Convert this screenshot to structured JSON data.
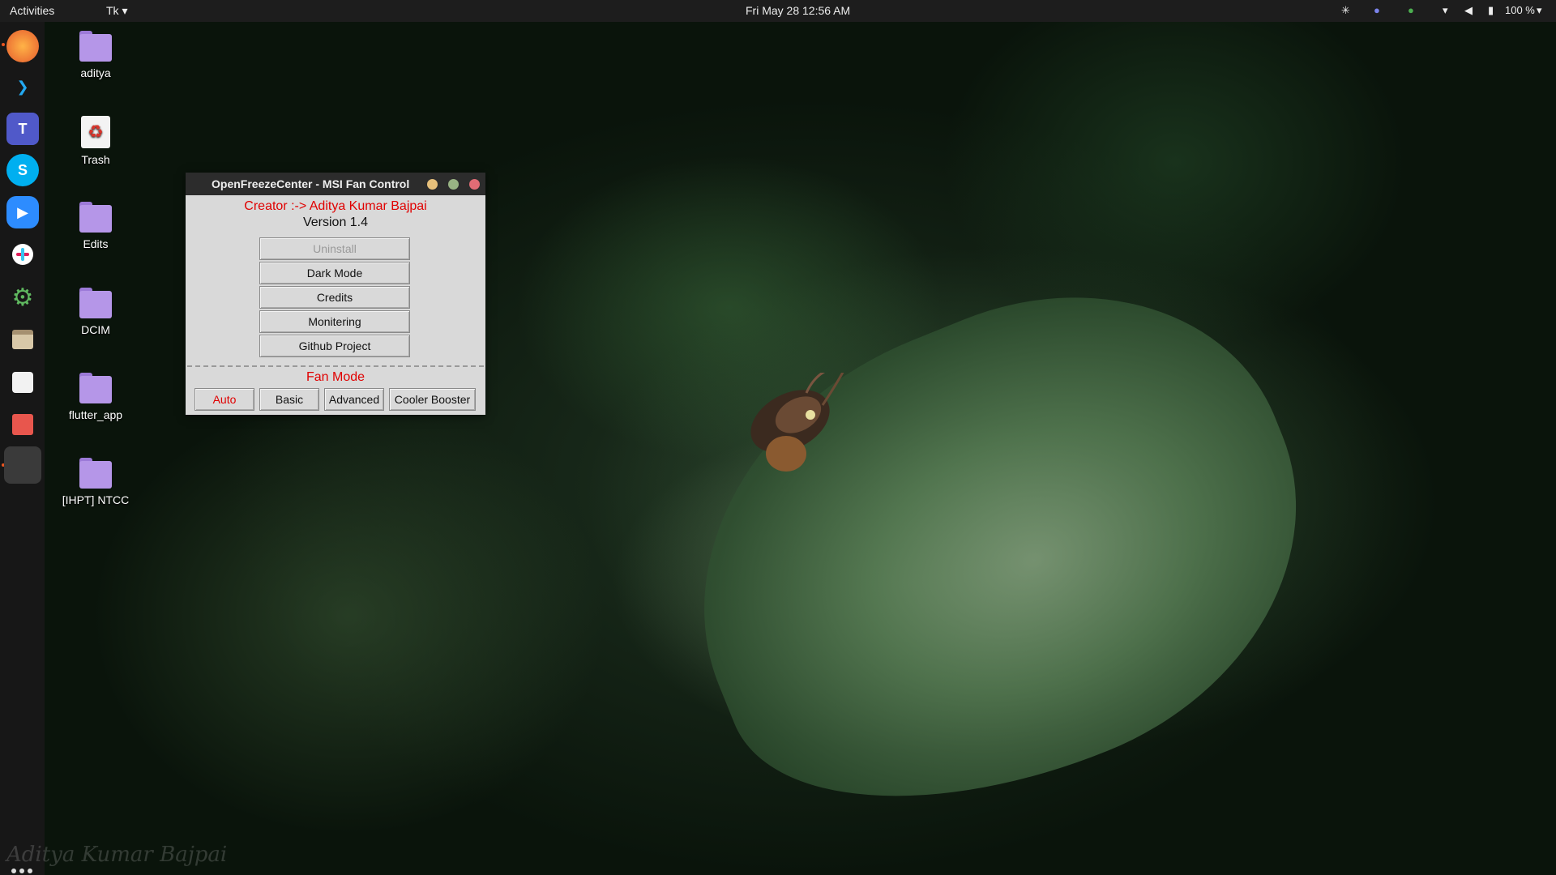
{
  "topbar": {
    "activities": "Activities",
    "app_menu": "Tk ▾",
    "clock": "Fri May 28  12:56 AM",
    "battery": "100 %",
    "tray_icons": [
      "slack-icon",
      "teams-icon",
      "check-shield-icon",
      "wifi-icon",
      "volume-icon",
      "battery-icon",
      "chevron-down-icon"
    ]
  },
  "dock": {
    "items": [
      "firefox-icon",
      "vscode-icon",
      "teams-icon",
      "skype-icon",
      "zoom-icon",
      "slack-icon",
      "settings-icon",
      "files-icon",
      "software-store-icon",
      "terminal-app-icon",
      "tk-window-icon"
    ],
    "show_apps": "show-applications-icon"
  },
  "desktop": {
    "icons": [
      {
        "label": "aditya",
        "type": "home-folder-icon"
      },
      {
        "label": "Trash",
        "type": "trash-icon"
      },
      {
        "label": "Edits",
        "type": "folder-icon"
      },
      {
        "label": "DCIM",
        "type": "folder-icon"
      },
      {
        "label": "flutter_app",
        "type": "folder-icon"
      },
      {
        "label": "[IHPT] NTCC",
        "type": "folder-icon"
      }
    ]
  },
  "window": {
    "title": "OpenFreezeCenter - MSI Fan Control",
    "creator": "Creator :-> Aditya Kumar Bajpai",
    "version": "Version 1.4",
    "menu_buttons": [
      {
        "label": "Uninstall",
        "disabled": true
      },
      {
        "label": "Dark Mode",
        "disabled": false
      },
      {
        "label": "Credits",
        "disabled": false
      },
      {
        "label": "Monitering",
        "disabled": false
      },
      {
        "label": "Github Project",
        "disabled": false
      }
    ],
    "fan_mode_label": "Fan Mode",
    "fan_modes": [
      {
        "label": "Auto",
        "active": true
      },
      {
        "label": "Basic",
        "active": false
      },
      {
        "label": "Advanced",
        "active": false
      },
      {
        "label": "Cooler Booster",
        "active": false
      }
    ]
  },
  "watermark": "Aditya Kumar Bajpai",
  "colors": {
    "accent_red": "#e00000",
    "folder": "#b596e8",
    "topbar": "#1d1d1d",
    "window_bg": "#d9d9d9"
  }
}
